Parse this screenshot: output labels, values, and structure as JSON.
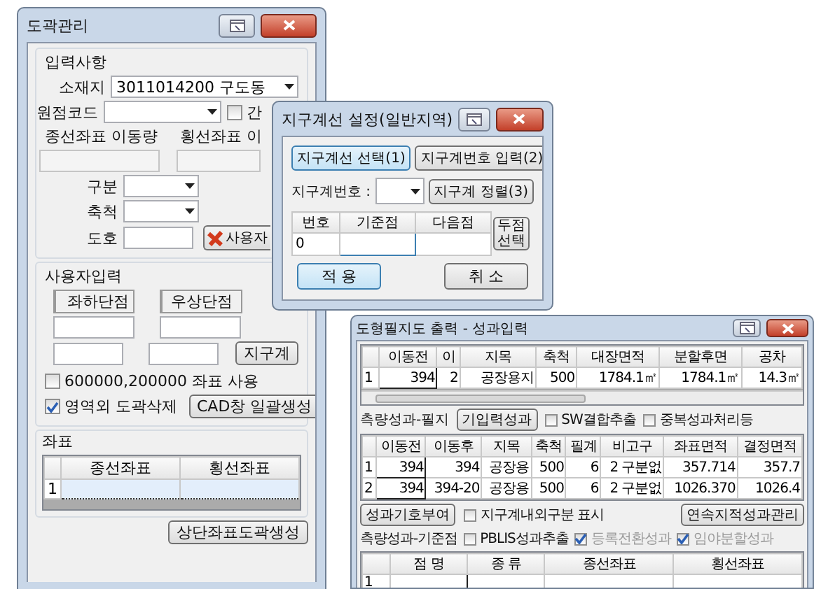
{
  "main_window": {
    "title": "도곽관리",
    "input_group": {
      "title": "입력사항",
      "location": {
        "label": "소재지",
        "value": "3011014200 구도동"
      },
      "origin_code": {
        "label": "원점코드"
      },
      "inter_check": {
        "label": "간",
        "checked": false
      },
      "x_shift_label": "종선좌표 이동량",
      "y_shift_label": "횡선좌표 이",
      "division": {
        "label": "구분"
      },
      "scale": {
        "label": "축척"
      },
      "sheet_no": {
        "label": "도호"
      },
      "user_sheet_button": "사용자"
    },
    "user_input": {
      "title": "사용자입력",
      "lower_left": "좌하단점",
      "upper_right": "우상단점",
      "boundary_button": "지구계",
      "checks": [
        {
          "label": "600000,200000 좌표 사용",
          "checked": false
        },
        {
          "label": "영역외 도곽삭제",
          "checked": true
        }
      ],
      "cad_button": "CAD창 일괄생성"
    },
    "coords": {
      "title": "좌표",
      "columns": [
        "종선좌표",
        "횡선좌표"
      ],
      "rows": [
        {
          "index": "1",
          "selected": true
        }
      ]
    },
    "generate_button": "상단좌표도곽생성"
  },
  "boundary_dialog": {
    "title": "지구계선 설정(일반지역)",
    "tabs": [
      {
        "label": "지구계선 선택(1)",
        "selected": true
      },
      {
        "label": "지구계번호 입력(2)",
        "selected": false
      }
    ],
    "number_label": "지구계번호 :",
    "sort_button": "지구계 정렬(3)",
    "columns": [
      "번호",
      "기준점",
      "다음점"
    ],
    "row": [
      "0"
    ],
    "two_point_button": "두점 선택",
    "ok_button": "적 용",
    "cancel_button": "취 소"
  },
  "result_window": {
    "title": "도형필지도 출력 - 성과입력",
    "parcel_table": {
      "columns": [
        "이동전",
        "이",
        "지목",
        "축척",
        "대장면적",
        "분할후면",
        "공차"
      ],
      "rows": [
        {
          "index": "1",
          "cells": [
            "394",
            "2",
            "공장용지",
            "500",
            "1784.1㎡",
            "1784.1㎡",
            "14.3㎡"
          ]
        }
      ]
    },
    "result_label": "측량성과-필지",
    "prior_button": "기입력성과",
    "checks": [
      {
        "label": "SW결합추출",
        "checked": false
      },
      {
        "label": "중복성과처리등",
        "checked": false
      }
    ],
    "result_table": {
      "columns": [
        "이동전",
        "이동후",
        "지목",
        "축척",
        "필계",
        "비고구",
        "좌표면적",
        "결정면적"
      ],
      "rows": [
        {
          "index": "1",
          "cells": [
            "394",
            "394",
            "공장용",
            "500",
            "6",
            "2 구분없",
            "357.714",
            "357.7"
          ]
        },
        {
          "index": "2",
          "cells": [
            "394",
            "394-20",
            "공장용",
            "500",
            "6",
            "2 구분없",
            "1026.370",
            "1026.4"
          ]
        }
      ]
    },
    "symbol_button": "성과기호부여",
    "boundary_check": {
      "label": "지구계내외구분 표시",
      "checked": false
    },
    "continuous_button": "연속지적성과관리",
    "control_label": "측량성과-기준점",
    "extract_checks": [
      {
        "label": "PBLIS성과추출",
        "checked": false,
        "disabled": false
      },
      {
        "label": "등록전환성과",
        "checked": true,
        "disabled": true
      },
      {
        "label": "임야분할성과",
        "checked": true,
        "disabled": true
      }
    ],
    "point_table": {
      "columns": [
        "점 명",
        "종 류",
        "종선좌표",
        "횡선좌표"
      ],
      "rows": [
        {
          "index": "1"
        }
      ]
    }
  }
}
